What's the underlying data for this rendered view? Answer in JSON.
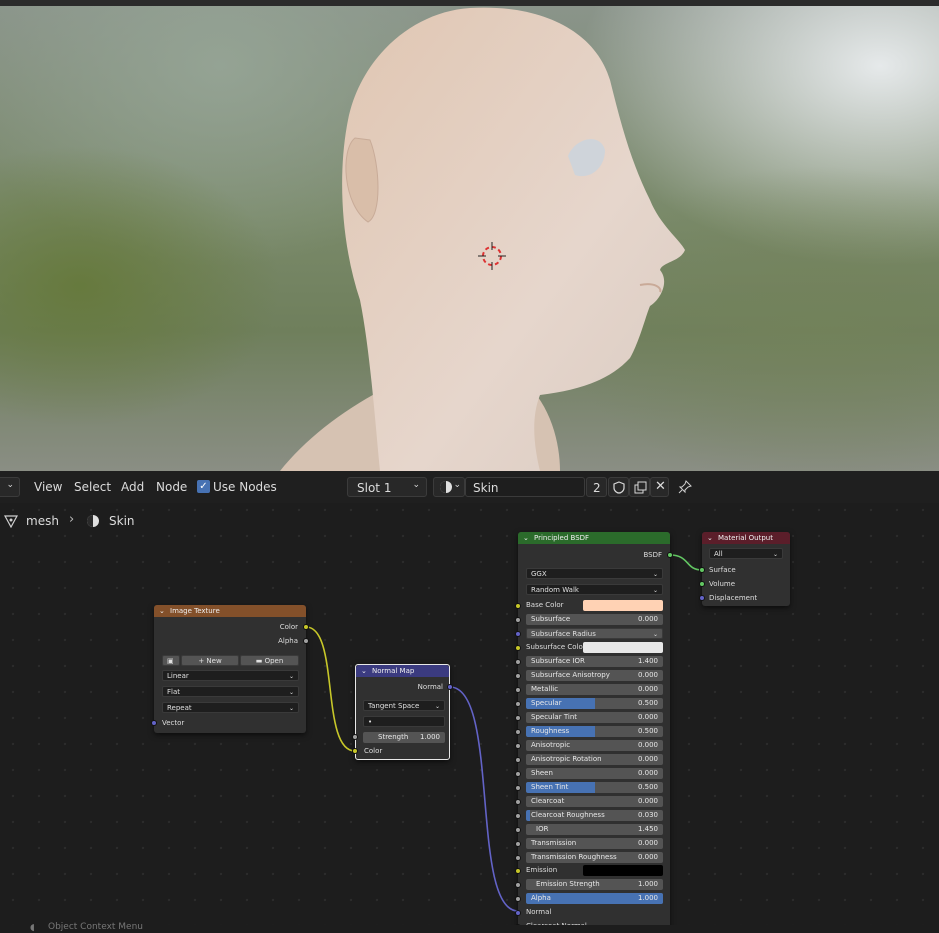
{
  "header": {
    "menu": [
      "View",
      "Select",
      "Add",
      "Node"
    ],
    "use_nodes_label": "Use Nodes",
    "use_nodes_checked": true,
    "slot_label": "Slot 1",
    "material_name": "Skin",
    "user_count": "2"
  },
  "breadcrumb": {
    "object": "mesh",
    "material": "Skin"
  },
  "viewport": {
    "accent_skin": "#ddc8b6"
  },
  "nodes": {
    "image_texture": {
      "title": "Image Texture",
      "outputs": [
        "Color",
        "Alpha"
      ],
      "new_label": "New",
      "open_label": "Open",
      "interpolation": "Linear",
      "projection": "Flat",
      "extension": "Repeat",
      "input": "Vector"
    },
    "normal_map": {
      "title": "Normal Map",
      "output": "Normal",
      "space": "Tangent Space",
      "uv_map": "",
      "strength_label": "Strength",
      "strength_value": "1.000",
      "input": "Color"
    },
    "principled": {
      "title": "Principled BSDF",
      "output": "BSDF",
      "distribution": "GGX",
      "subsurface_method": "Random Walk",
      "base_color_label": "Base Color",
      "base_color_hex": "#ffd2b4",
      "subsurface_color_label": "Subsurface Color",
      "subsurface_color_hex": "#e8e8e8",
      "subsurface_radius_label": "Subsurface Radius",
      "emission_label": "Emission",
      "emission_hex": "#000000",
      "normal_label": "Normal",
      "clearcoat_normal_label": "Clearcoat Normal",
      "fields": [
        {
          "label": "Subsurface",
          "value": "0.000",
          "fill": 0.0
        },
        {
          "label": "Subsurface IOR",
          "value": "1.400",
          "fill": 0.0
        },
        {
          "label": "Subsurface Anisotropy",
          "value": "0.000",
          "fill": 0.0
        },
        {
          "label": "Metallic",
          "value": "0.000",
          "fill": 0.0
        },
        {
          "label": "Specular",
          "value": "0.500",
          "fill": 0.5
        },
        {
          "label": "Specular Tint",
          "value": "0.000",
          "fill": 0.0
        },
        {
          "label": "Roughness",
          "value": "0.500",
          "fill": 0.5
        },
        {
          "label": "Anisotropic",
          "value": "0.000",
          "fill": 0.0
        },
        {
          "label": "Anisotropic Rotation",
          "value": "0.000",
          "fill": 0.0
        },
        {
          "label": "Sheen",
          "value": "0.000",
          "fill": 0.0
        },
        {
          "label": "Sheen Tint",
          "value": "0.500",
          "fill": 0.5
        },
        {
          "label": "Clearcoat",
          "value": "0.000",
          "fill": 0.0
        },
        {
          "label": "Clearcoat Roughness",
          "value": "0.030",
          "fill": 0.03
        },
        {
          "label": "IOR",
          "value": "1.450",
          "fill": 0.0
        },
        {
          "label": "Transmission",
          "value": "0.000",
          "fill": 0.0
        },
        {
          "label": "Transmission Roughness",
          "value": "0.000",
          "fill": 0.0
        },
        {
          "label": "Emission Strength",
          "value": "1.000",
          "fill": 0.0
        },
        {
          "label": "Alpha",
          "value": "1.000",
          "fill": 1.0
        }
      ]
    },
    "material_output": {
      "title": "Material Output",
      "target": "All",
      "inputs": [
        "Surface",
        "Volume",
        "Displacement"
      ]
    }
  },
  "footer": {
    "hint": "Object Context Menu"
  },
  "colors": {
    "image_texture_header": "#83502a",
    "normal_map_header": "#3b3b80",
    "principled_header": "#2b6b2b",
    "output_header": "#5b1e2a",
    "accent": "#4772b3"
  }
}
